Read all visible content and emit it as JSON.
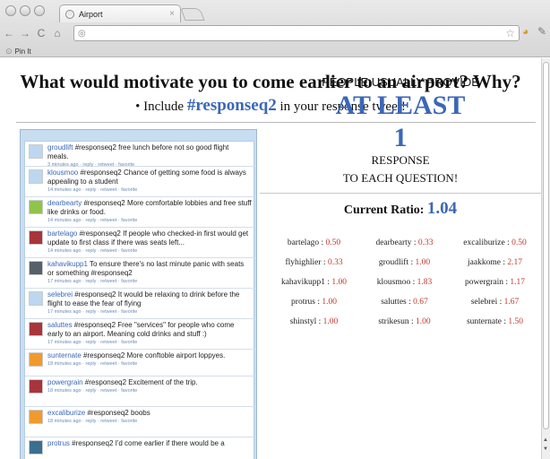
{
  "browser": {
    "tab_title": "Airport",
    "tab_close": "×",
    "bookmark": "Pin It"
  },
  "page": {
    "heading": "What would motivate you to come earlier to an airport? Why?",
    "sub_prefix": "• Include ",
    "sub_tag": "#responseq2",
    "sub_suffix": " in your response tweet!",
    "people": "PEOPLE USUALLY PROVIDE",
    "at_least": "AT LEAST",
    "count": "1",
    "response": "RESPONSE",
    "each_question": "TO EACH QUESTION!",
    "ratio_label": "Current Ratio: ",
    "ratio_value": "1.04"
  },
  "tweets": [
    {
      "user": "groudlift",
      "text": " #responseq2 free lunch before not so good flight meals.",
      "meta": "3 minutes ago · reply · retweet · favorite",
      "color": "#bcd7ef"
    },
    {
      "user": "klousmoo",
      "text": " #responseq2 Chance of getting some food is always appealing to a student",
      "meta": "14 minutes ago · reply · retweet · favorite",
      "color": "#bcd7ef"
    },
    {
      "user": "dearbearty",
      "text": " #responseq2 More comfortable lobbies and free stuff like drinks or food.",
      "meta": "14 minutes ago · reply · retweet · favorite",
      "color": "#8fc44a"
    },
    {
      "user": "bartelago",
      "text": " #responseq2 If people who checked-in first would get update to first class if there was seats left...",
      "meta": "14 minutes ago · reply · retweet · favorite",
      "color": "#a8353a"
    },
    {
      "user": "kahavikupp1",
      "text": " To ensure there's no last minute panic with seats or something #responseq2",
      "meta": "17 minutes ago · reply · retweet · favorite",
      "color": "#55606a"
    },
    {
      "user": "selebrei",
      "text": " #responseq2 It would be relaxing to drink before the flight to ease the fear of flying",
      "meta": "17 minutes ago · reply · retweet · favorite",
      "color": "#bcd7ef"
    },
    {
      "user": "saluttes",
      "text": " #responseq2 Free \"services\" for people who come early to an airport. Meaning cold drinks and stuff :)",
      "meta": "17 minutes ago · reply · retweet · favorite",
      "color": "#a8353a"
    },
    {
      "user": "sunternate",
      "text": " #responseq2 More conftoble airport loppyes.",
      "meta": "18 minutes ago · reply · retweet · favorite",
      "color": "#f09a2e"
    },
    {
      "user": "powergrain",
      "text": " #responseq2 Excitement of the trip.",
      "meta": "18 minutes ago · reply · retweet · favorite",
      "color": "#a8353a"
    },
    {
      "user": "excaliburize",
      "text": " #responseq2 boobs",
      "meta": "18 minutes ago · reply · retweet · favorite",
      "color": "#f09a2e"
    },
    {
      "user": "protrus",
      "text": " #responseq2 I'd come earlier if there would be a",
      "meta": "",
      "color": "#3b6f8f"
    }
  ],
  "leaderboard": [
    {
      "user": "bartelago",
      "value": "0.50"
    },
    {
      "user": "dearbearty",
      "value": "0.33"
    },
    {
      "user": "excaliburize",
      "value": "0.50"
    },
    {
      "user": "flyhighlier",
      "value": "0.33"
    },
    {
      "user": "groudlift",
      "value": "1.00"
    },
    {
      "user": "jaakkome",
      "value": "2.17"
    },
    {
      "user": "kahavikupp1",
      "value": "1.00"
    },
    {
      "user": "klousmoo",
      "value": "1.83"
    },
    {
      "user": "powergrain",
      "value": "1.17"
    },
    {
      "user": "protrus",
      "value": "1.00"
    },
    {
      "user": "saluttes",
      "value": "0.67"
    },
    {
      "user": "selebrei",
      "value": "1.67"
    },
    {
      "user": "shinstyl",
      "value": "1.00"
    },
    {
      "user": "strikesun",
      "value": "1.00"
    },
    {
      "user": "sunternate",
      "value": "1.50"
    }
  ]
}
